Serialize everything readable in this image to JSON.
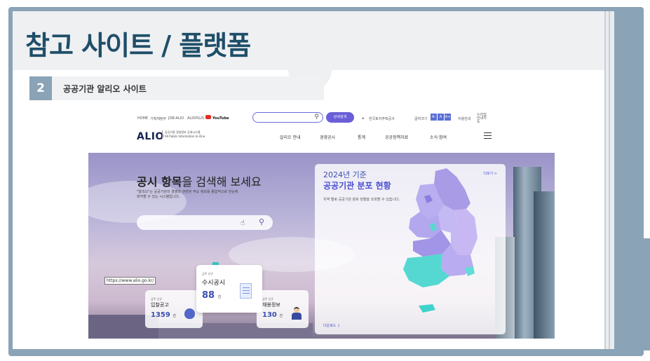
{
  "slide": {
    "title": "참고 사이트 / 플랫폼",
    "section_number": "2",
    "section_label": "공공기관 알리오 사이트"
  },
  "site": {
    "util_links": [
      "HOME",
      "기획재정부",
      "JOB-ALIO",
      "ALIOPLUS",
      "YouTube"
    ],
    "search_placeholder": "",
    "detail_search": "상세검색",
    "org_link": "한국토지주택공사",
    "font_size_label": "글자크기",
    "font_buttons": [
      "A-",
      "A",
      "A+"
    ],
    "guide_link": "이용안내",
    "accessibility_link": "누리집 안내지도",
    "logo": "ALIO",
    "logo_sub_1": "공공기관 경영정보 공개시스템",
    "logo_sub_2": "All Public Information In-One",
    "menu": [
      "알리오 안내",
      "경영공시",
      "통계",
      "공공정책자료",
      "소식·참여"
    ]
  },
  "hero": {
    "title_bold": "공시 항목",
    "title_rest": "을 검색해 보세요",
    "subtitle": "\"알리오\"는 공공기관의 경영과 관련된 주요 정보를 종합적으로 한눈에 파악할 수 있는 시스템입니다.",
    "search_placeholder": "",
    "url_tooltip": "https://www.alio.go.kr/",
    "cards": [
      {
        "tag": "금주 신규",
        "name": "입찰공고",
        "count": "1359",
        "unit": "건"
      },
      {
        "tag": "금주 신규",
        "name": "수시공시",
        "count": "88",
        "unit": "건"
      },
      {
        "tag": "금주 신규",
        "name": "채용정보",
        "count": "130",
        "unit": "건"
      }
    ]
  },
  "map_panel": {
    "year": "2024년 기준",
    "title": "공공기관 분포 현황",
    "description": "지역 별로 공공기관 분포 현황을 조회할 수 있습니다.",
    "more": "더보기 >",
    "download": "다운로드"
  },
  "colors": {
    "title_blue": "#1f4e69",
    "frame": "#8aa3b6",
    "site_accent": "#6a5fd8"
  }
}
